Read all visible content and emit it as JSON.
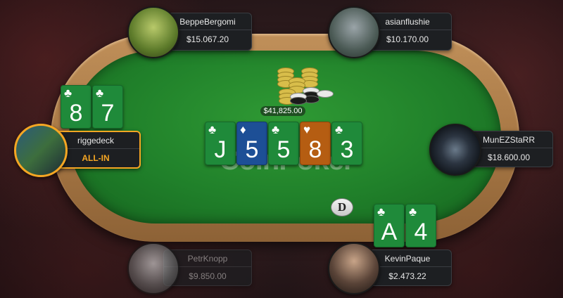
{
  "table": {
    "logo": "CoinPoker",
    "pot": "$41,825.00",
    "dealer_button": "D"
  },
  "community_cards": [
    {
      "rank": "J",
      "suit": "♣",
      "color": "club"
    },
    {
      "rank": "5",
      "suit": "♦",
      "color": "diamond"
    },
    {
      "rank": "5",
      "suit": "♣",
      "color": "club"
    },
    {
      "rank": "8",
      "suit": "♥",
      "color": "heart"
    },
    {
      "rank": "3",
      "suit": "♣",
      "color": "club"
    }
  ],
  "players": {
    "beppe": {
      "name": "BeppeBergomi",
      "stack": "$15.067.20"
    },
    "asian": {
      "name": "asianflushie",
      "stack": "$10.170.00"
    },
    "rigged": {
      "name": "riggedeck",
      "stack": "ALL-IN",
      "cards": [
        {
          "rank": "8",
          "suit": "♣"
        },
        {
          "rank": "7",
          "suit": "♣"
        }
      ]
    },
    "munez": {
      "name": "MunEZStaRR",
      "stack": "$18.600.00"
    },
    "petr": {
      "name": "PetrKnopp",
      "stack": "$9.850.00"
    },
    "kevin": {
      "name": "KevinPaque",
      "stack": "$2.473.22",
      "cards": [
        {
          "rank": "A",
          "suit": "♣"
        },
        {
          "rank": "4",
          "suit": "♣"
        }
      ]
    }
  },
  "colors": {
    "felt": "#20802a",
    "rail": "#a87845",
    "all_in": "#f5a623"
  }
}
